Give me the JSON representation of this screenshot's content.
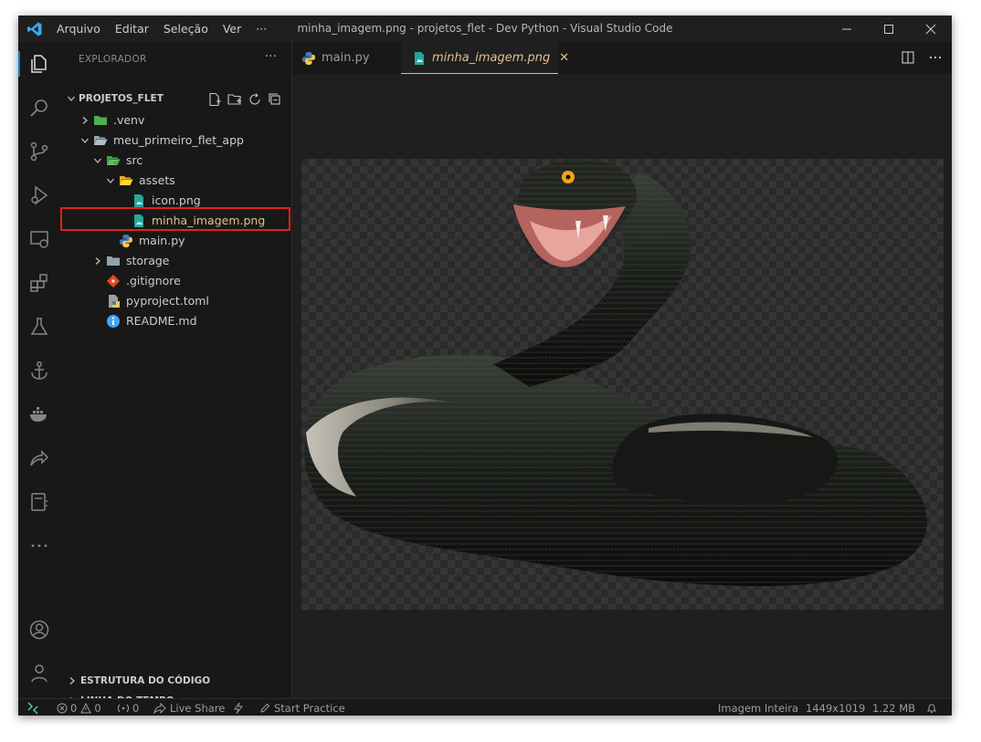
{
  "window": {
    "title": "minha_imagem.png - projetos_flet - Dev Python - Visual Studio Code",
    "menu": [
      "Arquivo",
      "Editar",
      "Seleção",
      "Ver",
      "···"
    ]
  },
  "sidebar": {
    "header": "EXPLORADOR",
    "more": "···",
    "project": "PROJETOS_FLET",
    "tree": {
      "venv": ".venv",
      "app": "meu_primeiro_flet_app",
      "src": "src",
      "assets": "assets",
      "icon": "icon.png",
      "minha": "minha_imagem.png",
      "main": "main.py",
      "storage": "storage",
      "gitignore": ".gitignore",
      "pyproject": "pyproject.toml",
      "readme": "README.md"
    },
    "sections": [
      "ESTRUTURA DO CÓDIGO",
      "LINHA DO TEMPO"
    ]
  },
  "tabs": [
    {
      "label": "main.py"
    },
    {
      "label": "minha_imagem.png",
      "close": "✕"
    }
  ],
  "editor": {
    "image_alt": "snake image"
  },
  "status": {
    "errors": "0",
    "warnings": "0",
    "ports": "0",
    "live_share": "Live Share",
    "start_practice": "Start Practice",
    "zoom": "Imagem Inteira",
    "dimensions": "1449x1019",
    "size": "1.22 MB"
  },
  "colors": {
    "accent": "#0078d4",
    "highlight": "#e02020",
    "modified_text": "#e2c08d"
  }
}
